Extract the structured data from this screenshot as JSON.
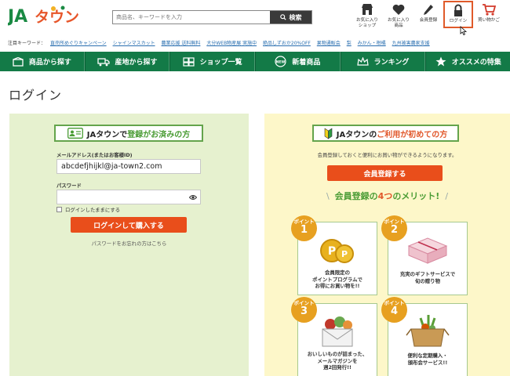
{
  "header": {
    "logo_text": "JAタウン",
    "search_placeholder": "商品名、キーワードを入力",
    "search_button": "検索",
    "icons": [
      {
        "name": "favorite-shop",
        "label_line1": "お気に入り",
        "label_line2": "ショップ"
      },
      {
        "name": "favorite-product",
        "label_line1": "お気に入り",
        "label_line2": "商品"
      },
      {
        "name": "register",
        "label_line1": "会員登録",
        "label_line2": ""
      },
      {
        "name": "login",
        "label_line1": "ログイン",
        "label_line2": ""
      },
      {
        "name": "cart",
        "label_line1": "買い物かご",
        "label_line2": ""
      }
    ]
  },
  "keywords": {
    "title": "注目キーワード：",
    "items": [
      "直売所めぐりキャンペーン",
      "シャインマスカット",
      "農業応援 送料無料",
      "大分WEB物産展 実施中",
      "絶品しずおか20%OFF",
      "果物通販会",
      "梨",
      "みかん・柑橘",
      "九州被害農家支援"
    ]
  },
  "nav": {
    "items": [
      {
        "label": "商品から探す",
        "icon": "box-icon"
      },
      {
        "label": "産地から探す",
        "icon": "truck-icon"
      },
      {
        "label": "ショップ一覧",
        "icon": "shop-icon"
      },
      {
        "label": "新着商品",
        "icon": "new-icon"
      },
      {
        "label": "ランキング",
        "icon": "crown-icon"
      },
      {
        "label": "オススメの特集",
        "icon": "star-icon"
      }
    ]
  },
  "page": {
    "title": "ログイン"
  },
  "login": {
    "heading_prefix": "JAタウンで",
    "heading_highlight": "登録がお済みの方",
    "email_label": "メールアドレス(またはお客様ID)",
    "email_value": "abcdefjhijkl@ja-town2.com",
    "password_label": "パスワード",
    "password_value": "",
    "remember_label": "ログインしたままにする",
    "submit_button": "ログインして購入する",
    "forgot_link": "パスワードをお忘れの方はこちら"
  },
  "register": {
    "heading_prefix": "JAタウンの",
    "heading_highlight": "ご利用が初めての方",
    "description": "会員登録しておくと便利にお買い物ができるようになります。",
    "register_button": "会員登録する",
    "merit_slash_left": "\\",
    "merit_title": "会員登録の",
    "merit_highlight": "4つ",
    "merit_suffix": "のメリット!",
    "merit_slash_right": "/",
    "points": [
      {
        "badge": "ポイント",
        "num": "1",
        "line1": "会員限定の",
        "line2": "ポイントプログラムで",
        "line3": "お得にお買い物を!!"
      },
      {
        "badge": "ポイント",
        "num": "2",
        "line1": "充実のギフトサービスで",
        "line2": "旬の贈り物",
        "line3": ""
      },
      {
        "badge": "ポイント",
        "num": "3",
        "line1": "おいしいものが詰まった、",
        "line2": "メールマガジンを",
        "line3": "週2回発行!!"
      },
      {
        "badge": "ポイント",
        "num": "4",
        "line1": "便利な定期購入・",
        "line2": "頒布会サービス!!",
        "line3": ""
      }
    ]
  },
  "colors": {
    "green": "#137a47",
    "orange": "#e94e1b",
    "login_bg": "#e6f1cf",
    "register_bg": "#fdf7c9"
  }
}
